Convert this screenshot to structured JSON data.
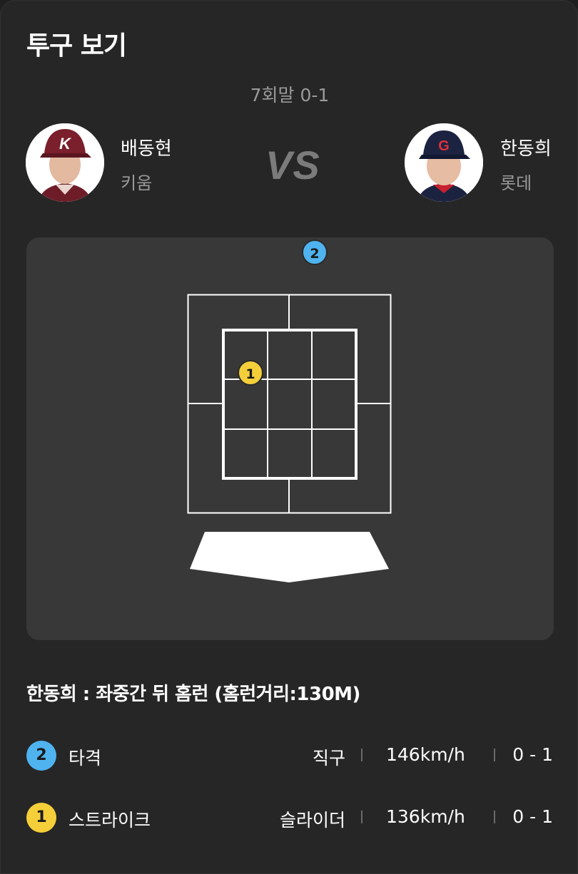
{
  "title": "투구 보기",
  "inning": "7회말 0-1",
  "pitcher": {
    "name": "배동현",
    "team": "키움",
    "cap_letter": "K",
    "cap_color": "#7a1f2b"
  },
  "batter": {
    "name": "한동희",
    "team": "롯데",
    "cap_letter": "G",
    "cap_color": "#1b2340"
  },
  "vs_label": "VS",
  "result": "한동희 : 좌중간 뒤 홈런 (홈런거리:130M)",
  "pitches": [
    {
      "number": "2",
      "label": "타격",
      "pitch_type": "직구",
      "speed": "146km/h",
      "count": "0 - 1",
      "color": "#4fb3f0"
    },
    {
      "number": "1",
      "label": "스트라이크",
      "pitch_type": "슬라이더",
      "speed": "136km/h",
      "count": "0 - 1",
      "color": "#f5cf3a"
    }
  ],
  "colors": {
    "background": "#262626",
    "panel": "#383838",
    "hit": "#4fb3f0",
    "strike": "#f5cf3a"
  }
}
